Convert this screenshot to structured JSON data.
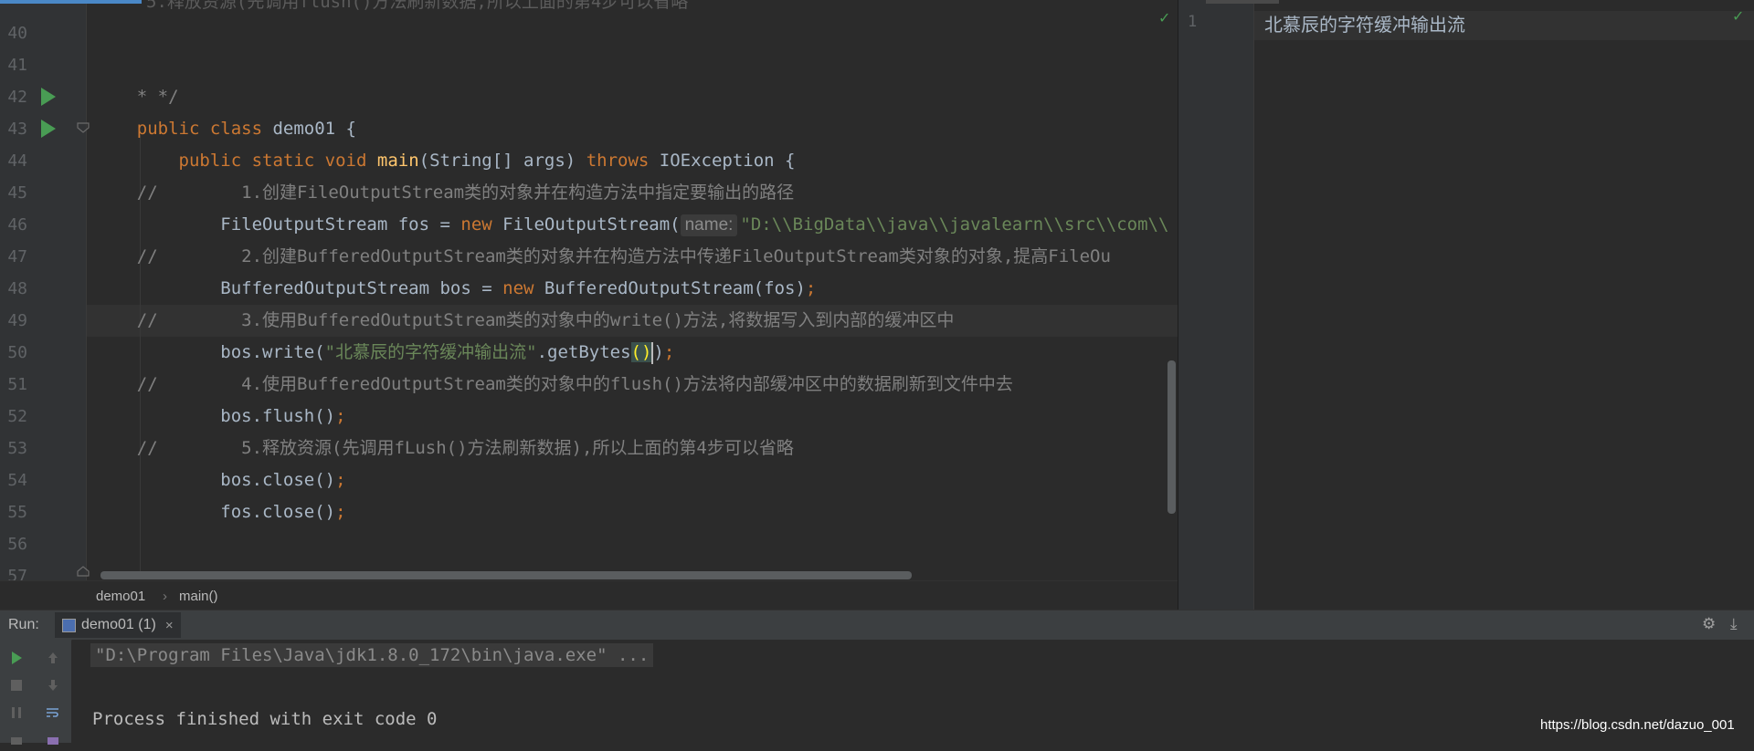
{
  "editor": {
    "top_partial_text": "5.释放资源(先调用flush()方法刷新数据,所以上面的第4步可以省略",
    "line_numbers": [
      "40",
      "41",
      "42",
      "43",
      "44",
      "45",
      "46",
      "47",
      "48",
      "49",
      "50",
      "51",
      "52",
      "53",
      "54",
      "55",
      "56",
      "57"
    ],
    "lines": {
      "l41": "* */",
      "l42_kw": "public class",
      "l42_rest": " demo01 {",
      "l43_kw1": "public static void",
      "l43_fn": "main",
      "l43_mid": "(String[] args) ",
      "l43_kw2": "throws",
      "l43_rest": " IOException {",
      "l44_a": "//",
      "l44_b": "        1.创建FileOutputStream类的对象并在构造方法中指定要输出的路径",
      "l45_a": "        FileOutputStream fos = ",
      "l45_kw": "new",
      "l45_b": " FileOutputStream(",
      "l45_hint": "name:",
      "l45_str": "\"D:\\\\BigData\\\\java\\\\javalearn\\\\src\\\\com\\\\",
      "l46_a": "//",
      "l46_b": "        2.创建BufferedOutputStream类的对象并在构造方法中传递FileOutputStream类对象的对象,提高FileOu",
      "l47_a": "        BufferedOutputStream bos = ",
      "l47_kw": "new",
      "l47_b": " BufferedOutputStream(fos)",
      "l47_semi": ";",
      "l48_a": "//",
      "l48_b": "        3.使用BufferedOutputStream类的对象中的write()方法,将数据写入到内部的缓冲区中",
      "l49_a": "        bos.write(",
      "l49_str": "\"北慕辰的字符缓冲输出流\"",
      "l49_b": ".getBytes",
      "l49_paren1": "(",
      "l49_paren2": ")",
      "l49_c": ")",
      "l49_semi": ";",
      "l50_a": "//",
      "l50_b": "        4.使用BufferedOutputStream类的对象中的flush()方法将内部缓冲区中的数据刷新到文件中去",
      "l51_a": "        bos.flush()",
      "l51_semi": ";",
      "l52_a": "//",
      "l52_b": "        5.释放资源(先调用fLush()方法刷新数据),所以上面的第4步可以省略",
      "l53_a": "        bos.close()",
      "l53_semi": ";",
      "l54_a": "        fos.close()",
      "l54_semi": ";",
      "l57": "    }"
    }
  },
  "breadcrumbs": {
    "class": "demo01",
    "separator": "›",
    "method": "main()"
  },
  "output_file": {
    "line_number": "1",
    "content": "北慕辰的字符缓冲输出流"
  },
  "run": {
    "label": "Run:",
    "tab_label": "demo01 (1)",
    "tab_close": "×",
    "command": "\"D:\\Program Files\\Java\\jdk1.8.0_172\\bin\\java.exe\" ...",
    "exit_message": "Process finished with exit code 0"
  },
  "icons": {
    "run_gutter": "play-triangle",
    "check": "✓",
    "gear": "⚙",
    "minimize": "⤓"
  },
  "watermark": "https://blog.csdn.net/dazuo_001",
  "colors": {
    "keyword": "#cc7832",
    "string": "#6a8759",
    "comment": "#808080",
    "function": "#ffc66d",
    "run_green": "#499c54"
  }
}
